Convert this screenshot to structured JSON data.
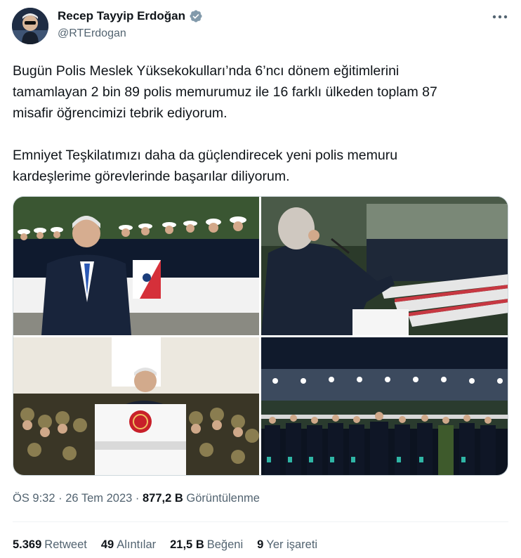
{
  "author": {
    "name": "Recep Tayyip Erdoğan",
    "handle": "@RTErdogan",
    "verified_icon": "verified-badge-icon"
  },
  "tweet": {
    "text": "Bugün Polis Meslek Yüksekokulları’nda 6’ncı dönem eğitimlerini\ntamamlayan 2 bin 89 polis memurumuz ile 16 farklı ülkeden toplam 87\nmisafir öğrencimizi tebrik ediyorum.\n\nEmniyet Teşkilatımızı daha da güçlendirecek yeni polis memuru\nkardeşlerime görevlerinde başarılar diliyorum."
  },
  "media": {
    "photos": [
      {
        "label": "photo-graduation-ranks"
      },
      {
        "label": "photo-speech-stadium"
      },
      {
        "label": "photo-podium-speech"
      },
      {
        "label": "photo-night-ceremony"
      }
    ]
  },
  "meta": {
    "time": "ÖS 9:32",
    "sep": " · ",
    "date": "26 Tem 2023",
    "views_count": "877,2 B",
    "views_label": "Görüntülenme"
  },
  "stats": [
    {
      "count": "5.369",
      "label": "Retweet"
    },
    {
      "count": "49",
      "label": "Alıntılar"
    },
    {
      "count": "21,5 B",
      "label": "Beğeni"
    },
    {
      "count": "9",
      "label": "Yer işareti"
    }
  ],
  "colors": {
    "text": "#0f1419",
    "secondary": "#536471",
    "verified": "#829aab",
    "border": "#cfd9de"
  }
}
